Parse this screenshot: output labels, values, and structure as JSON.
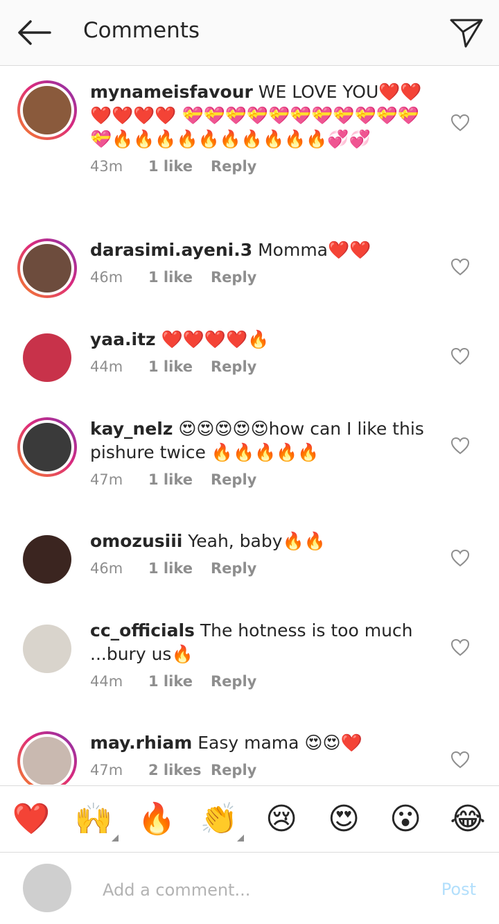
{
  "header": {
    "title": "Comments",
    "back_icon": "arrow-left-icon",
    "share_icon": "paper-plane-icon"
  },
  "comments": [
    {
      "username": "mynameisfavour",
      "text": "WE LOVE YOU❤️❤️❤️❤️❤️❤️ 💝💝💝💝💝💝💝💝💝💝💝💝🔥🔥🔥🔥🔥🔥🔥🔥🔥🔥💞💞",
      "time": "43m",
      "likes": "1 like",
      "reply": "Reply",
      "ring": true,
      "avatar_color": "#8a5a3c"
    },
    {
      "username": "darasimi.ayeni.3",
      "text": "Momma❤️❤️",
      "time": "46m",
      "likes": "1 like",
      "reply": "Reply",
      "ring": true,
      "avatar_color": "#6d4c3d"
    },
    {
      "username": "yaa.itz",
      "text": "❤️❤️❤️❤️🔥",
      "time": "44m",
      "likes": "1 like",
      "reply": "Reply",
      "ring": false,
      "avatar_color": "#c8324a"
    },
    {
      "username": "kay_nelz",
      "text": "😍😍😍😍😍how can I like this pishure twice 🔥🔥🔥🔥🔥",
      "time": "47m",
      "likes": "1 like",
      "reply": "Reply",
      "ring": true,
      "avatar_color": "#3a3a3a"
    },
    {
      "username": "omozusiii",
      "text": "Yeah, baby🔥🔥",
      "time": "46m",
      "likes": "1 like",
      "reply": "Reply",
      "ring": false,
      "avatar_color": "#3b2520"
    },
    {
      "username": "cc_officials",
      "text": "The hotness is too much ...bury us🔥",
      "time": "44m",
      "likes": "1 like",
      "reply": "Reply",
      "ring": false,
      "avatar_color": "#d9d4cc"
    },
    {
      "username": "may.rhiam",
      "text": "Easy mama 😍😍❤️",
      "time": "47m",
      "likes": "2 likes",
      "reply": "Reply",
      "ring": true,
      "avatar_color": "#c9b9b0"
    }
  ],
  "reactions": [
    {
      "emoji": "❤️",
      "icon": "red-heart-icon"
    },
    {
      "emoji": "🙌",
      "icon": "raising-hands-icon",
      "has_variants": true
    },
    {
      "emoji": "🔥",
      "icon": "fire-icon"
    },
    {
      "emoji": "👏",
      "icon": "clapping-hands-icon",
      "has_variants": true
    },
    {
      "emoji": "😢",
      "icon": "crying-face-icon"
    },
    {
      "emoji": "😍",
      "icon": "heart-eyes-icon"
    },
    {
      "emoji": "😮",
      "icon": "surprised-face-icon"
    },
    {
      "emoji": "😂",
      "icon": "tears-of-joy-icon"
    }
  ],
  "composer": {
    "placeholder": "Add a comment...",
    "post_label": "Post",
    "avatar_color": "#cfcfcf"
  },
  "colors": {
    "accent": "#0095f6",
    "post_disabled": "#b2dffc",
    "muted": "#8e8e8e"
  }
}
